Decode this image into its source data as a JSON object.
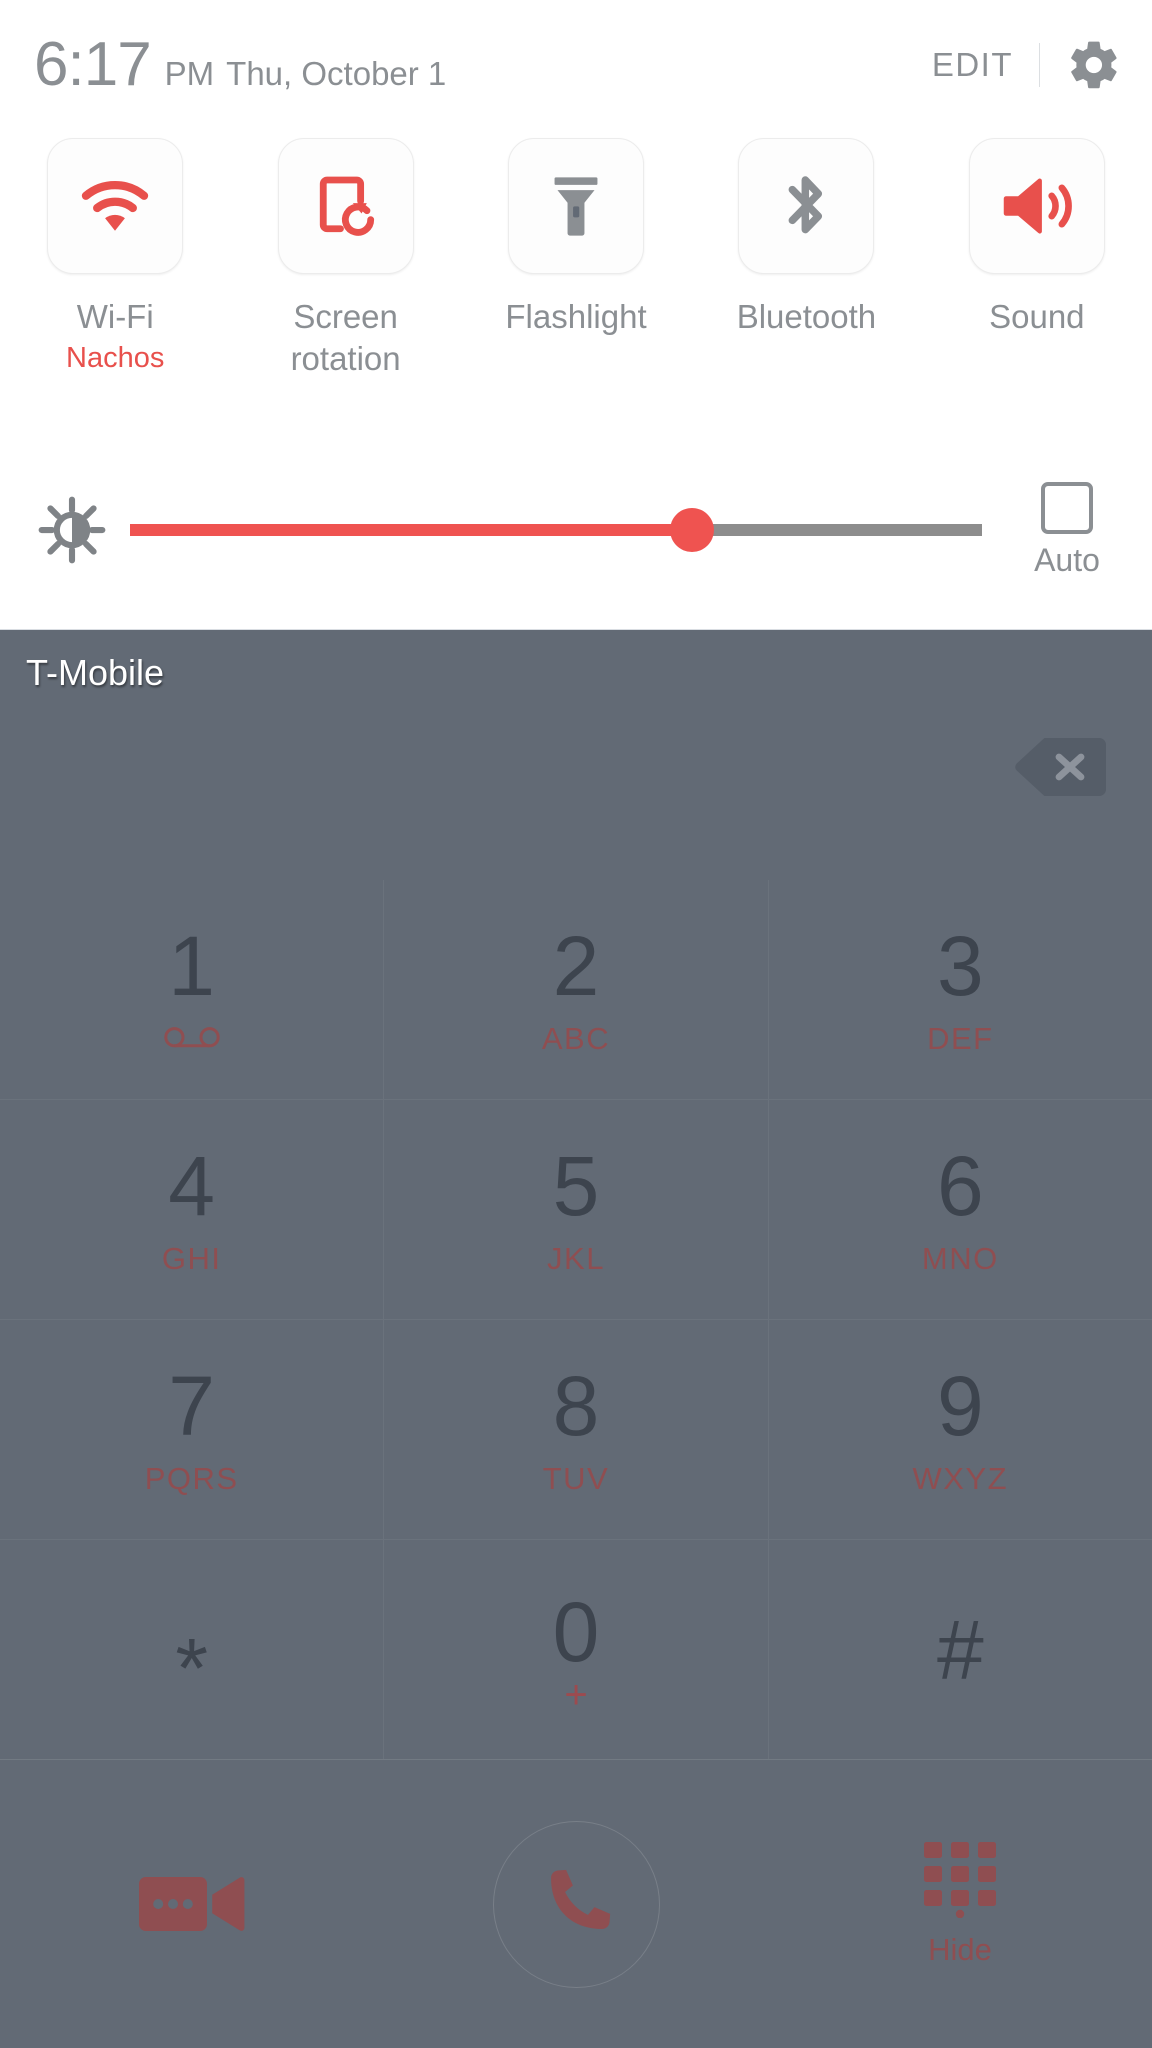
{
  "status_panel": {
    "clock": {
      "time": "6:17",
      "ampm": "PM",
      "date": "Thu, October 1"
    },
    "edit_label": "EDIT",
    "settings_icon": "gear-icon",
    "toggles": [
      {
        "label": "Wi-Fi",
        "sub": "Nachos",
        "icon": "wifi-icon",
        "active": true,
        "color": "#e8504c"
      },
      {
        "label": "Screen\nrotation",
        "sub": "",
        "icon": "screen-rotation-icon",
        "active": true,
        "color": "#e8504c"
      },
      {
        "label": "Flashlight",
        "sub": "",
        "icon": "flashlight-icon",
        "active": false,
        "color": "#8b8f93"
      },
      {
        "label": "Bluetooth",
        "sub": "",
        "icon": "bluetooth-icon",
        "active": false,
        "color": "#8b8f93"
      },
      {
        "label": "Sound",
        "sub": "",
        "icon": "sound-icon",
        "active": true,
        "color": "#e8504c"
      }
    ],
    "brightness": {
      "icon": "brightness-icon",
      "value_percent": 66,
      "auto_label": "Auto",
      "auto_checked": false,
      "fill_color": "#ef5350",
      "track_color": "#8d8d8d"
    }
  },
  "dialer": {
    "carrier": "T-Mobile",
    "backspace_icon": "backspace-icon",
    "input_value": "",
    "keys": [
      {
        "digit": "1",
        "letters": "",
        "icon": "voicemail-icon"
      },
      {
        "digit": "2",
        "letters": "ABC",
        "icon": ""
      },
      {
        "digit": "3",
        "letters": "DEF",
        "icon": ""
      },
      {
        "digit": "4",
        "letters": "GHI",
        "icon": ""
      },
      {
        "digit": "5",
        "letters": "JKL",
        "icon": ""
      },
      {
        "digit": "6",
        "letters": "MNO",
        "icon": ""
      },
      {
        "digit": "7",
        "letters": "PQRS",
        "icon": ""
      },
      {
        "digit": "8",
        "letters": "TUV",
        "icon": ""
      },
      {
        "digit": "9",
        "letters": "WXYZ",
        "icon": ""
      },
      {
        "digit": "*",
        "letters": "",
        "icon": ""
      },
      {
        "digit": "0",
        "letters": "+",
        "icon": ""
      },
      {
        "digit": "#",
        "letters": "",
        "icon": ""
      }
    ],
    "actions": {
      "video_call_icon": "video-call-icon",
      "call_icon": "phone-call-icon",
      "keypad_icon": "keypad-icon",
      "hide_label": "Hide"
    },
    "accent_color": "#8f4e51",
    "background_color": "#626a75"
  }
}
